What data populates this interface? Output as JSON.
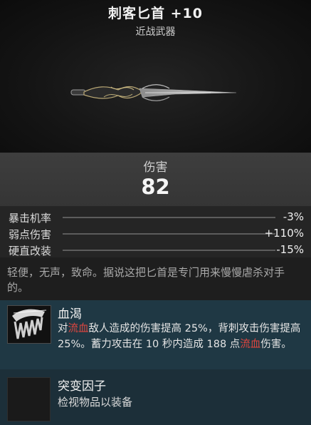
{
  "item": {
    "name": "刺客匕首 +10",
    "type": "近战武器"
  },
  "damage": {
    "label": "伤害",
    "value": "82"
  },
  "stats": [
    {
      "name": "暴击机率",
      "value": "-3%"
    },
    {
      "name": "弱点伤害",
      "value": "+110%"
    },
    {
      "name": "硬直改装",
      "value": "-15%"
    }
  ],
  "description": "轻便，无声，致命。据说这把匕首是专门用来慢慢虐杀对手的。",
  "perk": {
    "title": "血渴",
    "desc_parts": [
      "对",
      "流血",
      "敌人造成的伤害提高 25%，背刺攻击伤害提高 25%。蓄力攻击在 10 秒内造成 188 点",
      "流血",
      "伤害。"
    ],
    "icon": "blood-claw-icon",
    "highlight_color": "#e0463f"
  },
  "mutator": {
    "title": "突变因子",
    "desc": "检视物品以装备",
    "icon": "empty-slot-icon"
  }
}
